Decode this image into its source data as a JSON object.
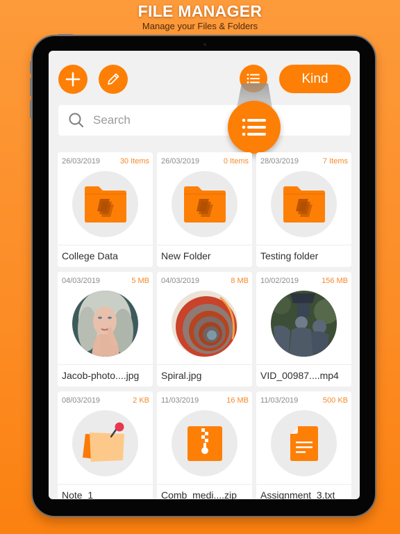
{
  "promo": {
    "title": "FILE MANAGER",
    "subtitle": "Manage your Files & Folders"
  },
  "toolbar": {
    "add_icon": "plus-icon",
    "edit_icon": "pencil-icon",
    "view_icon": "list-view-icon",
    "kind_label": "Kind"
  },
  "search": {
    "placeholder": "Search",
    "value": ""
  },
  "colors": {
    "accent": "#fd7f06",
    "size_text": "#f6882a",
    "background": "#fc8c25"
  },
  "files": [
    {
      "date": "26/03/2019",
      "size": "30 Items",
      "name": "College Data",
      "type": "folder"
    },
    {
      "date": "26/03/2019",
      "size": "0 Items",
      "name": "New Folder",
      "type": "folder"
    },
    {
      "date": "28/03/2019",
      "size": "7 Items",
      "name": "Testing folder",
      "type": "folder"
    },
    {
      "date": "04/03/2019",
      "size": "5 MB",
      "name": "Jacob-photo....jpg",
      "type": "photo-portrait"
    },
    {
      "date": "04/03/2019",
      "size": "8 MB",
      "name": "Spiral.jpg",
      "type": "photo-spiral"
    },
    {
      "date": "10/02/2019",
      "size": "156 MB",
      "name": "VID_00987....mp4",
      "type": "video-statue"
    },
    {
      "date": "08/03/2019",
      "size": "2 KB",
      "name": "Note_1",
      "type": "note"
    },
    {
      "date": "11/03/2019",
      "size": "16 MB",
      "name": "Comb_medi....zip",
      "type": "zip"
    },
    {
      "date": "11/03/2019",
      "size": "500 KB",
      "name": "Assignment_3.txt",
      "type": "text-document"
    }
  ]
}
